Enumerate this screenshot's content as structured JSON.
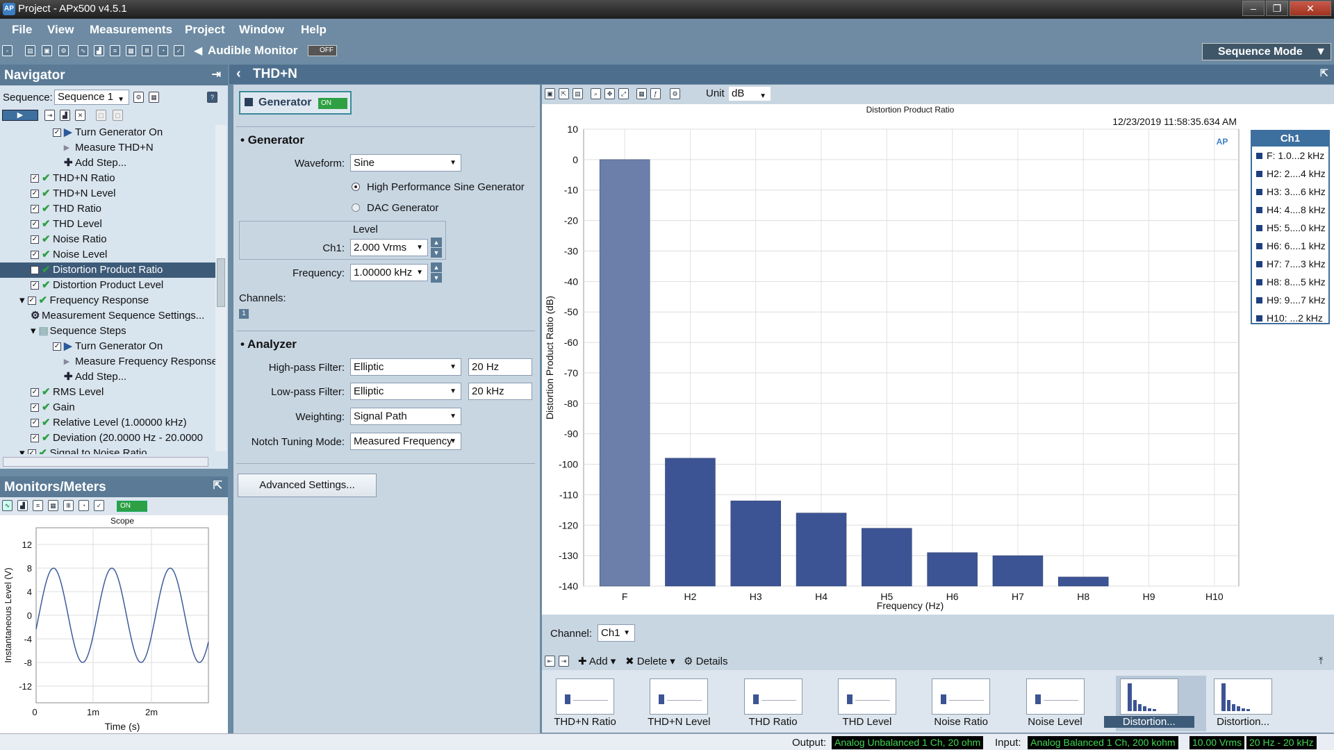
{
  "window": {
    "title": "Project - APx500 v4.5.1",
    "logo": "AP"
  },
  "menu": [
    "File",
    "View",
    "Measurements",
    "Project",
    "Window",
    "Help"
  ],
  "toolbar": {
    "audible_monitor": "Audible Monitor",
    "audible_state": "OFF",
    "sequence_mode": "Sequence Mode"
  },
  "navigator": {
    "title": "Navigator",
    "sequence_label": "Sequence:",
    "sequence_value": "Sequence 1",
    "items": [
      {
        "label": "Turn Generator On",
        "indent": 4,
        "kind": "chkplay"
      },
      {
        "label": "Measure THD+N",
        "indent": 4,
        "kind": "arrow"
      },
      {
        "label": "Add Step...",
        "indent": 4,
        "kind": "plus"
      },
      {
        "label": "THD+N Ratio",
        "indent": 2,
        "kind": "chkok"
      },
      {
        "label": "THD+N Level",
        "indent": 2,
        "kind": "chkok"
      },
      {
        "label": "THD Ratio",
        "indent": 2,
        "kind": "chkok"
      },
      {
        "label": "THD Level",
        "indent": 2,
        "kind": "chkok"
      },
      {
        "label": "Noise Ratio",
        "indent": 2,
        "kind": "chkok"
      },
      {
        "label": "Noise Level",
        "indent": 2,
        "kind": "chkok"
      },
      {
        "label": "Distortion Product Ratio",
        "indent": 2,
        "kind": "chkok",
        "selected": true
      },
      {
        "label": "Distortion Product Level",
        "indent": 2,
        "kind": "chkok"
      },
      {
        "label": "Frequency Response",
        "indent": 1,
        "kind": "group"
      },
      {
        "label": "Measurement Sequence Settings...",
        "indent": 2,
        "kind": "gear"
      },
      {
        "label": "Sequence Steps",
        "indent": 2,
        "kind": "folder"
      },
      {
        "label": "Turn Generator On",
        "indent": 4,
        "kind": "chkplay"
      },
      {
        "label": "Measure Frequency Response",
        "indent": 4,
        "kind": "arrow"
      },
      {
        "label": "Add Step...",
        "indent": 4,
        "kind": "plus"
      },
      {
        "label": "RMS Level",
        "indent": 2,
        "kind": "chkok"
      },
      {
        "label": "Gain",
        "indent": 2,
        "kind": "chkok"
      },
      {
        "label": "Relative Level (1.00000 kHz)",
        "indent": 2,
        "kind": "chkok"
      },
      {
        "label": "Deviation (20.0000 Hz - 20.0000",
        "indent": 2,
        "kind": "chkok"
      },
      {
        "label": "Signal to Noise Ratio",
        "indent": 1,
        "kind": "group"
      }
    ]
  },
  "monitors": {
    "title": "Monitors/Meters",
    "state": "ON",
    "scope_title": "Scope",
    "ylabel": "Instantaneous Level (V)",
    "xlabel": "Time (s)",
    "yticks": [
      "12",
      "8",
      "4",
      "0",
      "-4",
      "-8",
      "-12"
    ],
    "xticks": [
      "0",
      "1m",
      "2m"
    ]
  },
  "panel": {
    "title": "THD+N",
    "generator_label": "Generator",
    "generator_state": "ON",
    "generator_section": "Generator",
    "waveform_label": "Waveform:",
    "waveform_value": "Sine",
    "radio_hp": "High Performance Sine Generator",
    "radio_dac": "DAC Generator",
    "level_title": "Level",
    "ch1_label": "Ch1:",
    "ch1_value": "2.000 Vrms",
    "freq_label": "Frequency:",
    "freq_value": "1.00000 kHz",
    "channels_label": "Channels:",
    "channels_badge": "1",
    "analyzer_section": "Analyzer",
    "hp_label": "High-pass Filter:",
    "hp_value": "Elliptic",
    "hp_freq": "20 Hz",
    "lp_label": "Low-pass Filter:",
    "lp_value": "Elliptic",
    "lp_freq": "20 kHz",
    "weighting_label": "Weighting:",
    "weighting_value": "Signal Path",
    "notch_label": "Notch Tuning Mode:",
    "notch_value": "Measured Frequency",
    "advanced_button": "Advanced Settings..."
  },
  "graph": {
    "unit_label": "Unit",
    "unit_value": "dB",
    "timestamp": "12/23/2019 11:58:35.634 AM",
    "channel_label": "Channel:",
    "channel_value": "Ch1",
    "legend_header": "Ch1",
    "legend": [
      "F: 1.0...2 kHz",
      "H2: 2....4 kHz",
      "H3: 3....6 kHz",
      "H4: 4....8 kHz",
      "H5: 5....0 kHz",
      "H6: 6....1 kHz",
      "H7: 7....3 kHz",
      "H8: 8....5 kHz",
      "H9: 9....7 kHz",
      "H10: ...2 kHz"
    ],
    "bar_color": "#3d5494",
    "first_bar_color": "#6b7faa"
  },
  "chart_data": {
    "type": "bar",
    "title": "Distortion Product Ratio",
    "xlabel": "Frequency (Hz)",
    "ylabel": "Distortion Product Ratio (dB)",
    "categories": [
      "F",
      "H2",
      "H3",
      "H4",
      "H5",
      "H6",
      "H7",
      "H8",
      "H9",
      "H10"
    ],
    "values": [
      0,
      -98,
      -112,
      -116,
      -121,
      -129,
      -130,
      -137,
      null,
      null
    ],
    "ylim": [
      -140,
      10
    ],
    "yticks": [
      10,
      0,
      -10,
      -20,
      -30,
      -40,
      -50,
      -60,
      -70,
      -80,
      -90,
      -100,
      -110,
      -120,
      -130,
      -140
    ],
    "grid": true,
    "legend_position": "right"
  },
  "results": {
    "add": "Add",
    "delete": "Delete",
    "details": "Details",
    "thumbs": [
      "THD+N Ratio",
      "THD+N Level",
      "THD Ratio",
      "THD Level",
      "Noise Ratio",
      "Noise Level",
      "Distortion...",
      "Distortion..."
    ]
  },
  "status": {
    "output_label": "Output:",
    "output_value": "Analog Unbalanced 1 Ch, 20 ohm",
    "input_label": "Input:",
    "input_value": "Analog Balanced 1 Ch, 200 kohm",
    "level_value": "10.00 Vrms",
    "bandwidth_value": "20 Hz - 20 kHz"
  }
}
